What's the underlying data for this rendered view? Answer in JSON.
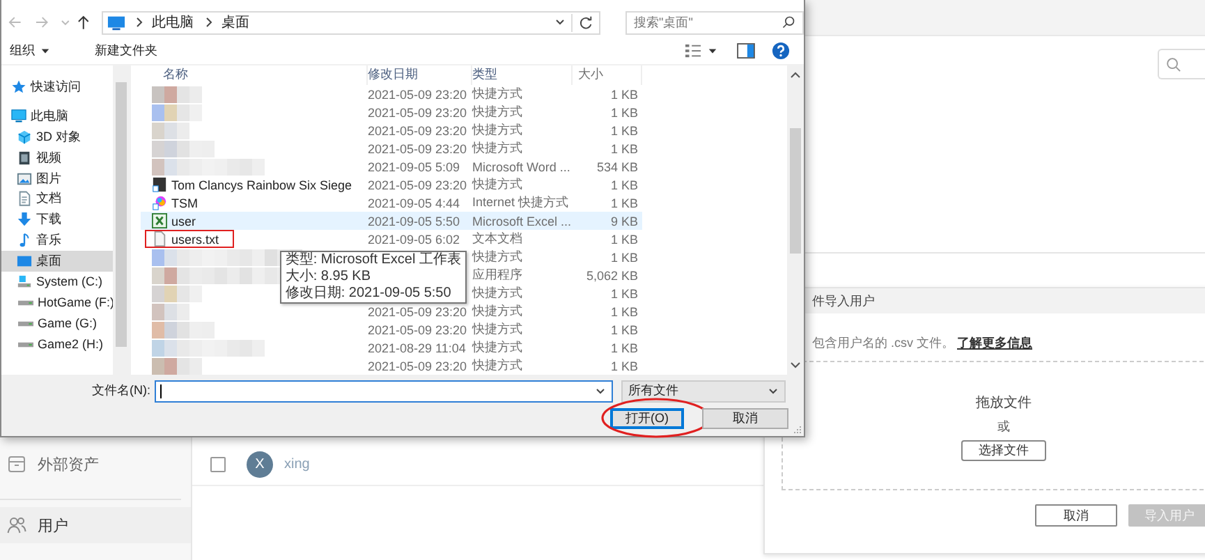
{
  "dialog": {
    "breadcrumb": [
      "此电脑",
      "桌面"
    ],
    "search": {
      "placeholder": "搜索\"桌面\""
    },
    "toolbar": [
      {
        "label": "组织",
        "menu": true
      },
      {
        "label": "新建文件夹",
        "menu": false
      }
    ],
    "nav": [
      {
        "label": "快速访问",
        "selected": false
      },
      {
        "label": "此电脑",
        "selected": false,
        "children": [
          {
            "label": "3D 对象",
            "selected": false
          },
          {
            "label": "视频",
            "selected": false
          },
          {
            "label": "图片",
            "selected": false
          },
          {
            "label": "文档",
            "selected": false
          },
          {
            "label": "下载",
            "selected": false
          },
          {
            "label": "音乐",
            "selected": false
          },
          {
            "label": "桌面",
            "selected": true
          },
          {
            "label": "System (C:)",
            "selected": false
          },
          {
            "label": "HotGame (F:)",
            "selected": false
          },
          {
            "label": "Game (G:)",
            "selected": false
          },
          {
            "label": "Game2 (H:)",
            "selected": false
          }
        ]
      }
    ],
    "columns": [
      "名称",
      "修改日期",
      "类型",
      "大小"
    ],
    "files": [
      {
        "kind": "blurred",
        "date": "2021-05-09 23:20",
        "type": "快捷方式",
        "size": "1 KB",
        "hovered": false,
        "outlined": false
      },
      {
        "kind": "blurred",
        "date": "2021-05-09 23:20",
        "type": "快捷方式",
        "size": "1 KB",
        "hovered": false,
        "outlined": false
      },
      {
        "kind": "blurred",
        "date": "2021-05-09 23:20",
        "type": "快捷方式",
        "size": "1 KB",
        "hovered": false,
        "outlined": false
      },
      {
        "kind": "blurred",
        "date": "2021-05-09 23:20",
        "type": "快捷方式",
        "size": "1 KB",
        "hovered": false,
        "outlined": false
      },
      {
        "kind": "blurred",
        "date": "2021-09-05 5:09",
        "type": "Microsoft Word ...",
        "size": "534 KB",
        "hovered": false,
        "outlined": false
      },
      {
        "kind": "shortcut",
        "name": "Tom Clancys Rainbow Six Siege",
        "date": "2021-05-09 23:20",
        "type": "快捷方式",
        "size": "1 KB",
        "hovered": false,
        "outlined": false
      },
      {
        "kind": "web",
        "name": "TSM",
        "date": "2021-09-05 4:44",
        "type": "Internet 快捷方式",
        "size": "1 KB",
        "hovered": false,
        "outlined": false
      },
      {
        "kind": "sheet",
        "name": "user",
        "date": "2021-09-05 5:50",
        "type": "Microsoft Excel ...",
        "size": "9 KB",
        "hovered": true,
        "outlined": false
      },
      {
        "kind": "text",
        "name": "users.txt",
        "date": "2021-09-05 6:02",
        "type": "文本文档",
        "size": "1 KB",
        "hovered": false,
        "outlined": true
      },
      {
        "kind": "blurred",
        "type": "快捷方式",
        "size": "1 KB",
        "hovered": false,
        "outlined": false
      },
      {
        "kind": "blurred",
        "type": "应用程序",
        "size": "5,062 KB",
        "hovered": false,
        "outlined": false
      },
      {
        "kind": "blurred",
        "type": "快捷方式",
        "size": "1 KB",
        "hovered": false,
        "outlined": false
      },
      {
        "kind": "blurred",
        "date": "2021-05-09 23:20",
        "type": "快捷方式",
        "size": "1 KB",
        "hovered": false,
        "outlined": false
      },
      {
        "kind": "blurred",
        "date": "2021-05-09 23:20",
        "type": "快捷方式",
        "size": "1 KB",
        "hovered": false,
        "outlined": false
      },
      {
        "kind": "blurred",
        "date": "2021-08-29 11:04",
        "type": "快捷方式",
        "size": "1 KB",
        "hovered": false,
        "outlined": false
      },
      {
        "kind": "blurred",
        "date": "2021-05-09 23:20",
        "type": "快捷方式",
        "size": "1 KB",
        "hovered": false,
        "outlined": false
      }
    ],
    "tooltip": [
      "类型: Microsoft Excel 工作表",
      "大小: 8.95 KB",
      "修改日期: 2021-09-05 5:50"
    ],
    "filename": {
      "label": "文件名(N):"
    },
    "filetype": "所有文件",
    "buttons": [
      {
        "label": "打开(O)",
        "default": true,
        "circled": true
      },
      {
        "label": "取消",
        "default": false,
        "circled": false
      }
    ]
  },
  "app": {
    "sidebar": [
      {
        "label": "外部资产",
        "selected": false
      },
      {
        "label": "用户",
        "selected": true
      }
    ],
    "users": [
      {
        "initial": "X",
        "name": "xing",
        "checked": false
      }
    ],
    "import": {
      "title": "件导入用户",
      "hint": "包含用户名的 .csv 文件。",
      "link": "了解更多信息",
      "drop_text": "拖放文件",
      "or": "或",
      "choose_button": "选择文件",
      "buttons": [
        {
          "label": "取消",
          "disabled": false
        },
        {
          "label": "导入用户",
          "disabled": true
        }
      ]
    }
  }
}
